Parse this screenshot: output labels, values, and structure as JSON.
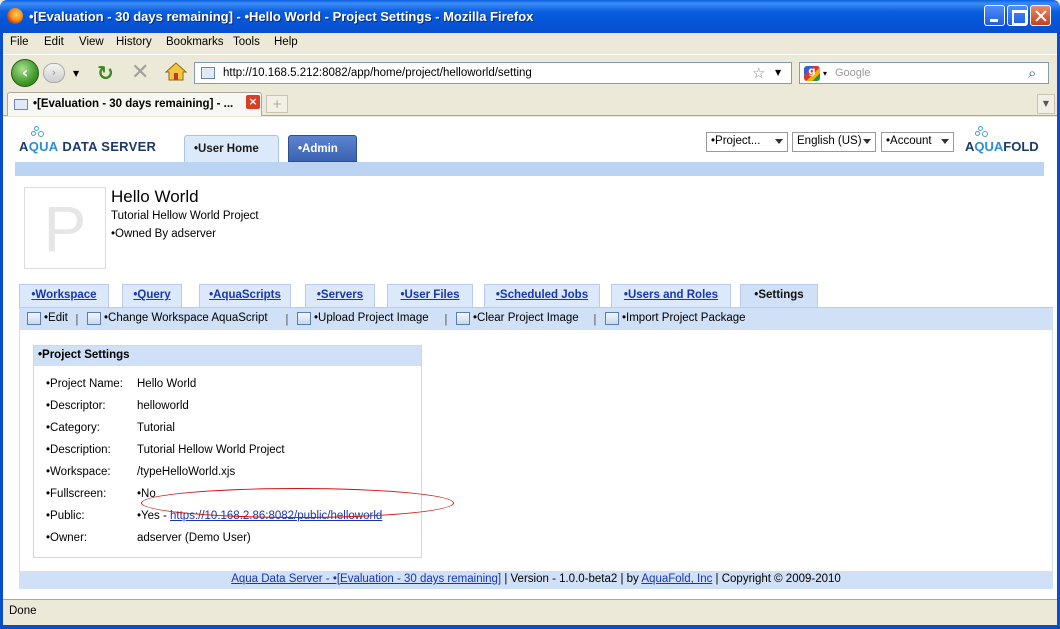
{
  "window": {
    "title": "•[Evaluation - 30 days remaining] - •Hello World - Project Settings - Mozilla Firefox"
  },
  "menu": [
    "File",
    "Edit",
    "View",
    "History",
    "Bookmarks",
    "Tools",
    "Help"
  ],
  "navbar": {
    "url": "http://10.168.5.212:8082/app/home/project/helloworld/setting",
    "search_placeholder": "Google"
  },
  "browser_tab": {
    "title": "•[Evaluation - 30 days remaining] - ..."
  },
  "header": {
    "app_logo_pre": "A",
    "app_logo_accent": "QUA",
    "app_logo_post": " DATA SERVER",
    "tabs": [
      "•User Home",
      "•Admin"
    ],
    "project_select": "•Project...",
    "language_select": "English (US)",
    "account_select": "•Account",
    "brand_pre": "A",
    "brand_accent": "QUA",
    "brand_post": "FOLD"
  },
  "project": {
    "avatar_letter": "P",
    "title": "Hello World",
    "description": "Tutorial Hellow World Project",
    "owner_line": "•Owned By adserver"
  },
  "workspace_tabs": [
    "•Workspace",
    "•Query",
    "•AquaScripts",
    "•Servers",
    "•User Files",
    "•Scheduled Jobs",
    "•Users and Roles",
    "•Settings"
  ],
  "actions": [
    "•Edit",
    "•Change Workspace AquaScript",
    "•Upload Project Image",
    "•Clear Project Image",
    "•Import Project Package"
  ],
  "settings": {
    "panel_title": "•Project Settings",
    "rows": [
      {
        "label": "•Project Name:",
        "value": "Hello World"
      },
      {
        "label": "•Descriptor:",
        "value": "helloworld"
      },
      {
        "label": "•Category:",
        "value": "Tutorial"
      },
      {
        "label": "•Description:",
        "value": "Tutorial Hellow World Project"
      },
      {
        "label": "•Workspace:",
        "value": "/typeHelloWorld.xjs"
      },
      {
        "label": "•Fullscreen:",
        "value": "•No"
      },
      {
        "label": "•Public:",
        "value": "•Yes - ",
        "link": "https://10.168.2.86:8082/public/helloworld"
      },
      {
        "label": "•Owner:",
        "value": "adserver (Demo User)"
      }
    ]
  },
  "footer": {
    "product_link": "Aqua Data Server - •[Evaluation - 30 days remaining]",
    "version_text": " | Version - 1.0.0-beta2 | by ",
    "company_link": "AquaFold, Inc",
    "copyright": " | Copyright © 2009-2010"
  },
  "status": "Done"
}
